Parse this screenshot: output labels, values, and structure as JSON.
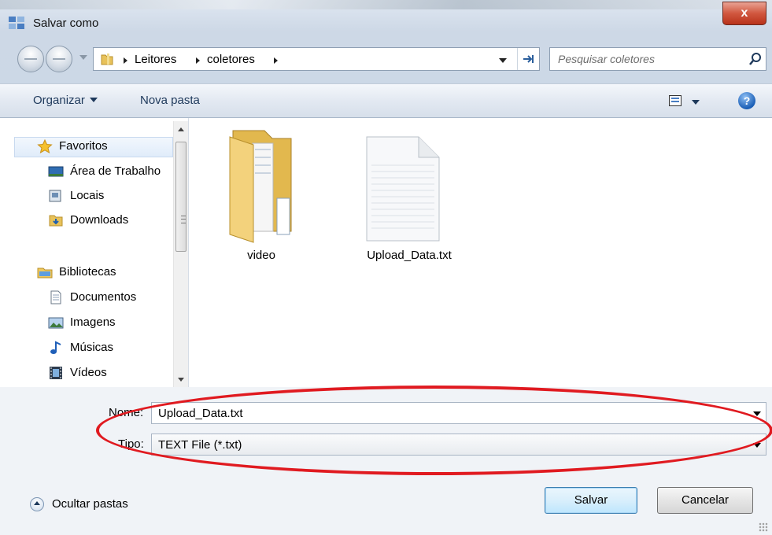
{
  "window": {
    "title": "Salvar como",
    "close_label": "x"
  },
  "address_bar": {
    "breadcrumbs": [
      "Leitores",
      "coletores"
    ],
    "refresh_icon": "refresh-icon"
  },
  "search": {
    "placeholder": "Pesquisar coletores"
  },
  "toolbar": {
    "organize_label": "Organizar",
    "new_folder_label": "Nova pasta",
    "help_label": "?"
  },
  "nav_pane": {
    "favorites": {
      "label": "Favoritos",
      "items": [
        "Área de Trabalho",
        "Locais",
        "Downloads"
      ]
    },
    "libraries": {
      "label": "Bibliotecas",
      "items": [
        "Documentos",
        "Imagens",
        "Músicas",
        "Vídeos"
      ]
    }
  },
  "files": [
    {
      "name": "video",
      "type": "folder"
    },
    {
      "name": "Upload_Data.txt",
      "type": "text-file"
    }
  ],
  "form": {
    "name_label": "Nome:",
    "name_value": "Upload_Data.txt",
    "type_label": "Tipo:",
    "type_value": "TEXT File (*.txt)"
  },
  "footer": {
    "hide_folders_label": "Ocultar pastas",
    "save_label": "Salvar",
    "cancel_label": "Cancelar"
  },
  "colors": {
    "annotation_ring": "#e01a20",
    "close_button": "#c8442d",
    "toolbar_text": "#1e395b"
  }
}
